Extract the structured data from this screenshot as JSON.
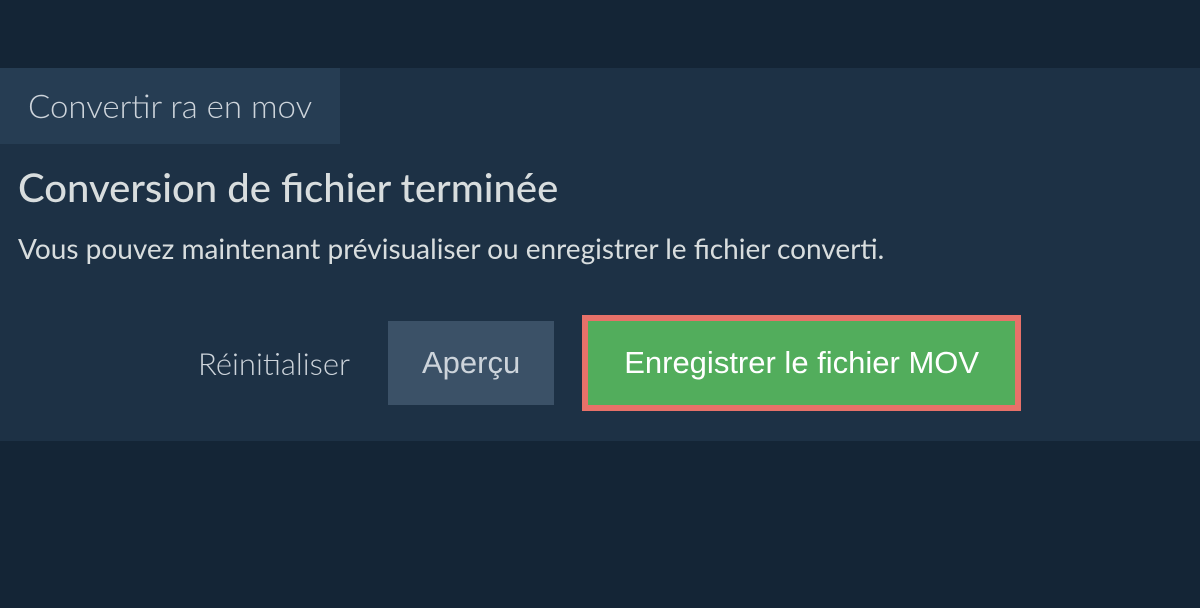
{
  "tab": {
    "label": "Convertir ra en mov"
  },
  "main": {
    "heading": "Conversion de fichier terminée",
    "subtext": "Vous pouvez maintenant prévisualiser ou enregistrer le fichier converti."
  },
  "actions": {
    "reset_label": "Réinitialiser",
    "preview_label": "Aperçu",
    "save_label": "Enregistrer le fichier MOV"
  }
}
